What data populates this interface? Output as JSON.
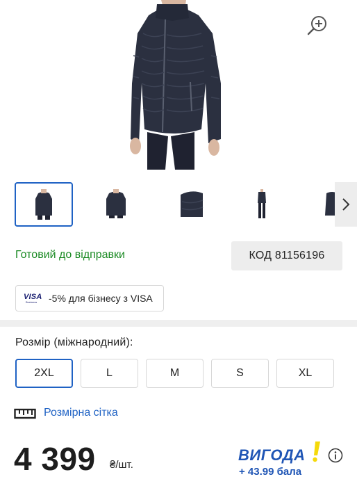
{
  "product": {
    "availability": "Готовий до відправки",
    "code_label": "КОД 81156196"
  },
  "promo": {
    "card_brand": "VISA",
    "card_sub": "Business",
    "text": "-5% для бізнесу з VISA"
  },
  "size": {
    "label": "Розмір (міжнародний):",
    "options": [
      "2XL",
      "L",
      "M",
      "S",
      "XL"
    ],
    "selected": "2XL",
    "chart_link": "Розмірна сітка"
  },
  "price": {
    "amount": "4 399",
    "unit": "₴/шт."
  },
  "loyalty": {
    "brand": "ВИГОДА",
    "points": "+ 43.99 бала"
  },
  "icons": {
    "zoom": "zoom-in-icon",
    "next": "chevron-right-icon",
    "ruler": "ruler-icon",
    "info": "info-icon"
  },
  "colors": {
    "accent": "#1f62c4",
    "available": "#1a8a23",
    "brand_blue": "#1f55b5",
    "brand_yellow": "#f5d90a",
    "jacket": "#2b3040"
  }
}
